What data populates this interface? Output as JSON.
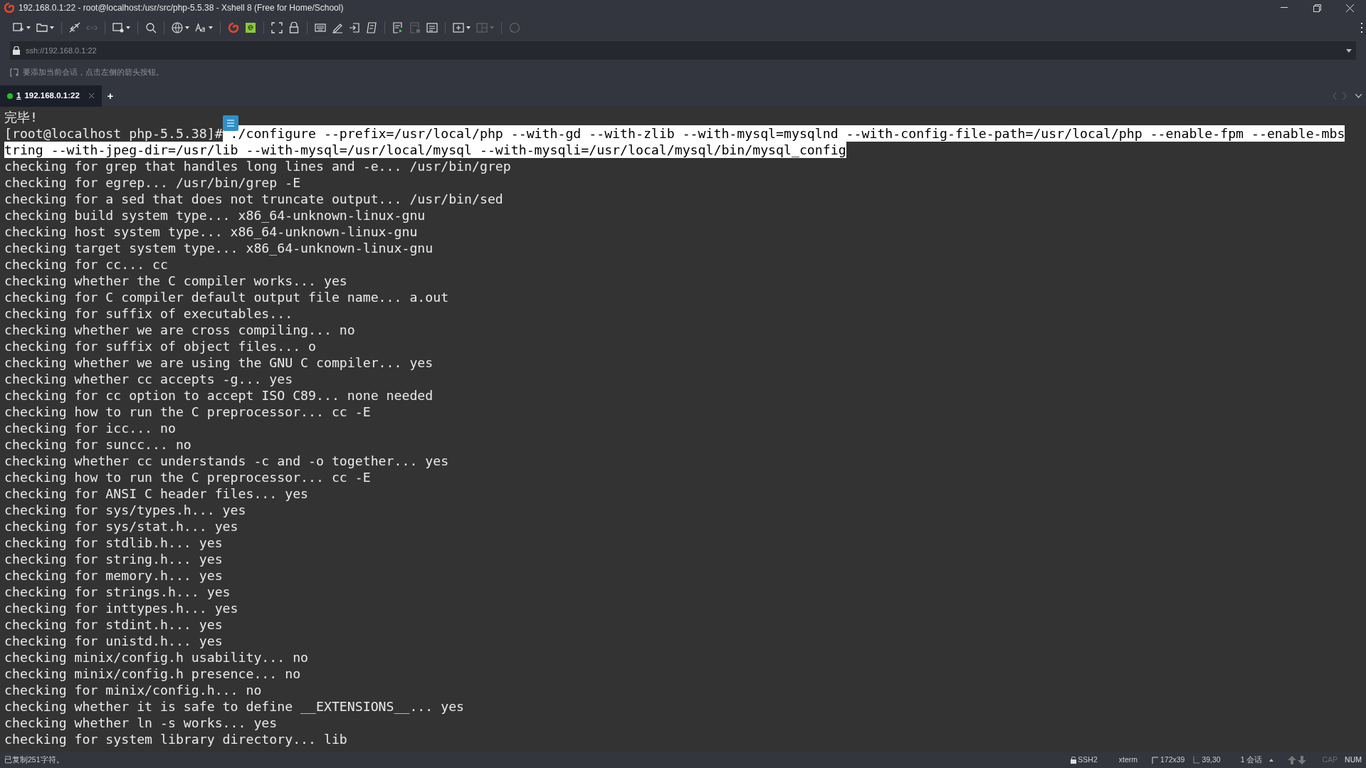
{
  "window": {
    "title": "192.168.0.1:22 - root@localhost:/usr/src/php-5.5.38 - Xshell 8 (Free for Home/School)"
  },
  "address_bar": {
    "value": "ssh://192.168.0.1:22"
  },
  "hint": "要添加当前会话，点击左侧的箭头按钮。",
  "tabs": [
    {
      "number": "1",
      "label": "192.168.0.1:22",
      "selected": true,
      "connected": true
    }
  ],
  "new_tab_button": "+",
  "terminal": {
    "lines": [
      {
        "segments": [
          {
            "text": "完毕!",
            "selected": false
          }
        ]
      },
      {
        "segments": [
          {
            "text": "[root@localhost php-5.5.38]#",
            "selected": false
          },
          {
            "text": " ./configure --prefix=/usr/local/php --with-gd --with-zlib --with-mysql=mysqlnd --with-config-file-path=/usr/local/php --enable-fpm --enable-mbs",
            "selected": true
          }
        ]
      },
      {
        "segments": [
          {
            "text": "tring --with-jpeg-dir=/usr/lib --with-mysql=/usr/local/mysql --with-mysqli=/usr/local/mysql/bin/mysql_config",
            "selected": true
          }
        ]
      },
      {
        "segments": [
          {
            "text": "checking for grep that handles long lines and -e... /usr/bin/grep",
            "selected": false
          }
        ]
      },
      {
        "segments": [
          {
            "text": "checking for egrep... /usr/bin/grep -E",
            "selected": false
          }
        ]
      },
      {
        "segments": [
          {
            "text": "checking for a sed that does not truncate output... /usr/bin/sed",
            "selected": false
          }
        ]
      },
      {
        "segments": [
          {
            "text": "checking build system type... x86_64-unknown-linux-gnu",
            "selected": false
          }
        ]
      },
      {
        "segments": [
          {
            "text": "checking host system type... x86_64-unknown-linux-gnu",
            "selected": false
          }
        ]
      },
      {
        "segments": [
          {
            "text": "checking target system type... x86_64-unknown-linux-gnu",
            "selected": false
          }
        ]
      },
      {
        "segments": [
          {
            "text": "checking for cc... cc",
            "selected": false
          }
        ]
      },
      {
        "segments": [
          {
            "text": "checking whether the C compiler works... yes",
            "selected": false
          }
        ]
      },
      {
        "segments": [
          {
            "text": "checking for C compiler default output file name... a.out",
            "selected": false
          }
        ]
      },
      {
        "segments": [
          {
            "text": "checking for suffix of executables...",
            "selected": false
          }
        ]
      },
      {
        "segments": [
          {
            "text": "checking whether we are cross compiling... no",
            "selected": false
          }
        ]
      },
      {
        "segments": [
          {
            "text": "checking for suffix of object files... o",
            "selected": false
          }
        ]
      },
      {
        "segments": [
          {
            "text": "checking whether we are using the GNU C compiler... yes",
            "selected": false
          }
        ]
      },
      {
        "segments": [
          {
            "text": "checking whether cc accepts -g... yes",
            "selected": false
          }
        ]
      },
      {
        "segments": [
          {
            "text": "checking for cc option to accept ISO C89... none needed",
            "selected": false
          }
        ]
      },
      {
        "segments": [
          {
            "text": "checking how to run the C preprocessor... cc -E",
            "selected": false
          }
        ]
      },
      {
        "segments": [
          {
            "text": "checking for icc... no",
            "selected": false
          }
        ]
      },
      {
        "segments": [
          {
            "text": "checking for suncc... no",
            "selected": false
          }
        ]
      },
      {
        "segments": [
          {
            "text": "checking whether cc understands -c and -o together... yes",
            "selected": false
          }
        ]
      },
      {
        "segments": [
          {
            "text": "checking how to run the C preprocessor... cc -E",
            "selected": false
          }
        ]
      },
      {
        "segments": [
          {
            "text": "checking for ANSI C header files... yes",
            "selected": false
          }
        ]
      },
      {
        "segments": [
          {
            "text": "checking for sys/types.h... yes",
            "selected": false
          }
        ]
      },
      {
        "segments": [
          {
            "text": "checking for sys/stat.h... yes",
            "selected": false
          }
        ]
      },
      {
        "segments": [
          {
            "text": "checking for stdlib.h... yes",
            "selected": false
          }
        ]
      },
      {
        "segments": [
          {
            "text": "checking for string.h... yes",
            "selected": false
          }
        ]
      },
      {
        "segments": [
          {
            "text": "checking for memory.h... yes",
            "selected": false
          }
        ]
      },
      {
        "segments": [
          {
            "text": "checking for strings.h... yes",
            "selected": false
          }
        ]
      },
      {
        "segments": [
          {
            "text": "checking for inttypes.h... yes",
            "selected": false
          }
        ]
      },
      {
        "segments": [
          {
            "text": "checking for stdint.h... yes",
            "selected": false
          }
        ]
      },
      {
        "segments": [
          {
            "text": "checking for unistd.h... yes",
            "selected": false
          }
        ]
      },
      {
        "segments": [
          {
            "text": "checking minix/config.h usability... no",
            "selected": false
          }
        ]
      },
      {
        "segments": [
          {
            "text": "checking minix/config.h presence... no",
            "selected": false
          }
        ]
      },
      {
        "segments": [
          {
            "text": "checking for minix/config.h... no",
            "selected": false
          }
        ]
      },
      {
        "segments": [
          {
            "text": "checking whether it is safe to define __EXTENSIONS__... yes",
            "selected": false
          }
        ]
      },
      {
        "segments": [
          {
            "text": "checking whether ln -s works... yes",
            "selected": false
          }
        ]
      },
      {
        "segments": [
          {
            "text": "checking for system library directory... lib",
            "selected": false
          }
        ]
      }
    ]
  },
  "status_bar": {
    "message": "已复制251字符。",
    "protocol": "SSH2",
    "terminal_type": "xterm",
    "size": "172x39",
    "cursor": "39,30",
    "sessions": "1 会话",
    "indicators": [
      {
        "label": "CAP",
        "on": false
      },
      {
        "label": "NUM",
        "on": true
      }
    ]
  }
}
